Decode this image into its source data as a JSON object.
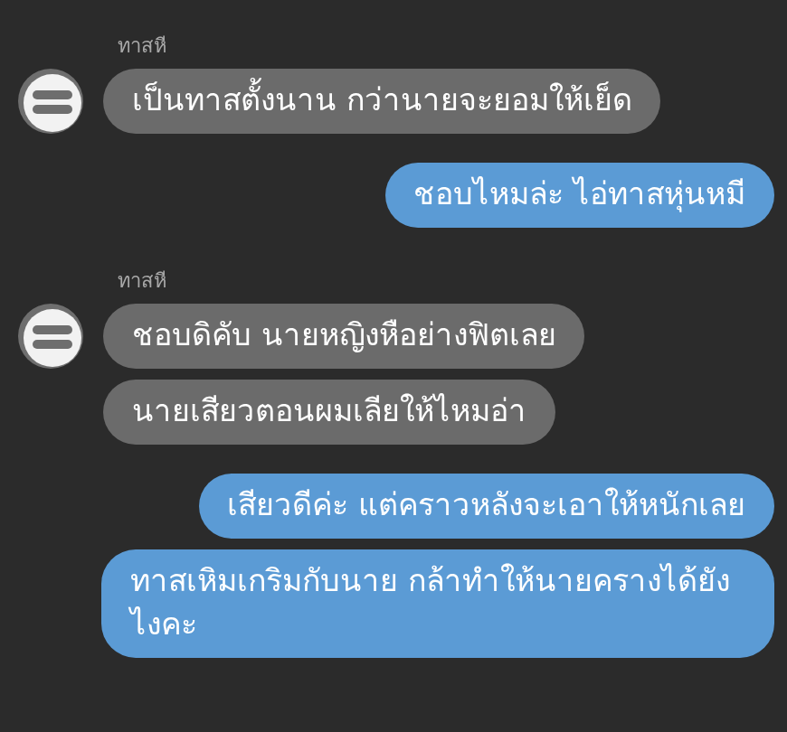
{
  "messages": [
    {
      "kind": "incoming",
      "sender": "ทาสหี",
      "bubbles": [
        "เป็นทาสตั้งนาน กว่านายจะยอมให้เย็ด"
      ]
    },
    {
      "kind": "outgoing",
      "bubbles": [
        "ชอบไหมล่ะ ไอ่ทาสหุ่นหมี"
      ]
    },
    {
      "kind": "incoming",
      "sender": "ทาสหี",
      "bubbles": [
        "ชอบดิคับ นายหญิงหือย่างฟิตเลย",
        "นายเสียวตอนผมเลียให้ไหมอ่า"
      ]
    },
    {
      "kind": "outgoing",
      "bubbles": [
        "เสียวดีค่ะ แต่คราวหลังจะเอาให้หนักเลย",
        "ทาสเหิมเกริมกับนาย กล้าทำให้นายครางได้ยังไงคะ"
      ]
    }
  ]
}
